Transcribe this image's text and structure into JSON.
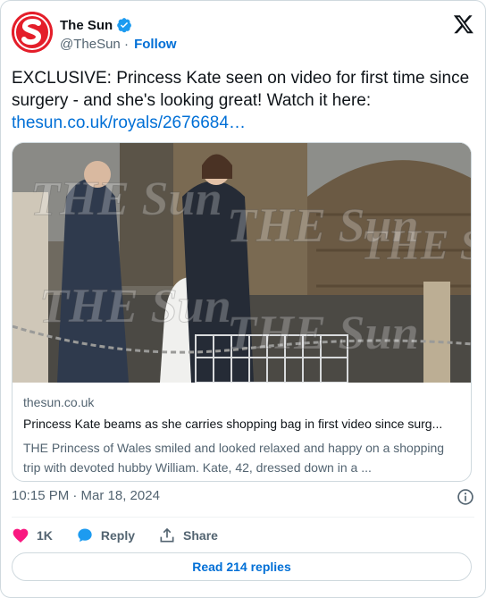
{
  "account": {
    "name": "The Sun",
    "handle": "@TheSun",
    "separator": "·",
    "follow_label": "Follow",
    "avatar_icon": "the-sun-logo",
    "brand_color": "#e41e2a",
    "verified_color": "#1d9bf0"
  },
  "tweet": {
    "text": "EXCLUSIVE: Princess Kate seen on video for first time since surgery - and she's looking great! Watch it here:",
    "link": "thesun.co.uk/royals/2676684…"
  },
  "link_card": {
    "image_icon": "news-photo",
    "watermark": "THE Sun",
    "domain": "thesun.co.uk",
    "title": "Princess Kate beams as she carries shopping bag in first video since surg...",
    "description": "THE Princess of Wales smiled and looked relaxed and happy on a shopping trip with devoted hubby William. Kate, 42, dressed down in a ..."
  },
  "timestamp": "10:15 PM · Mar 18, 2024",
  "actions": {
    "like_count": "1K",
    "reply_label": "Reply",
    "share_label": "Share"
  },
  "read_replies_label": "Read 214 replies",
  "colors": {
    "link": "#006fd6",
    "like": "#f91880",
    "reply": "#1d9bf0",
    "muted": "#536471",
    "border": "#cfd9de"
  }
}
